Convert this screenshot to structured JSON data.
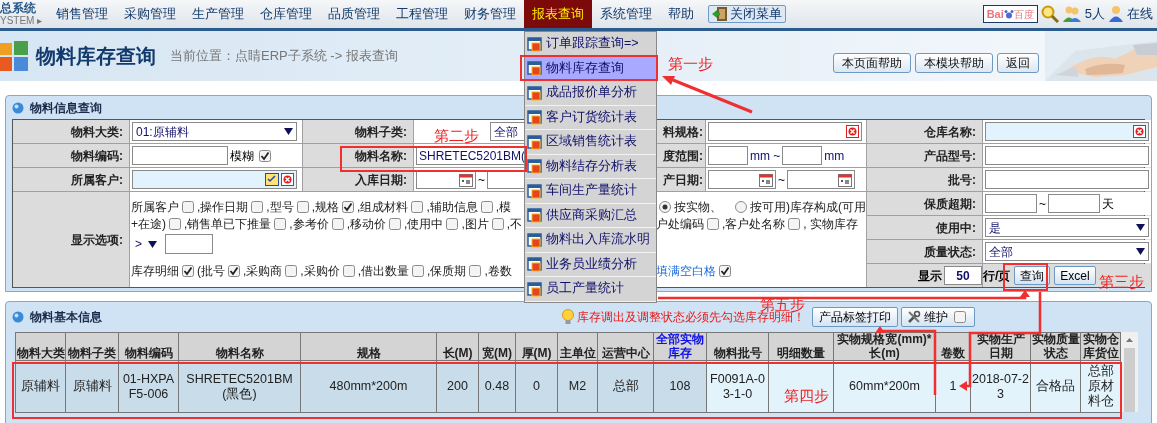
{
  "top_nav": {
    "logo_text": "总系统",
    "logo_sub": "YSTEM ▸",
    "items": [
      {
        "label": "销售管理",
        "selected": false
      },
      {
        "label": "采购管理",
        "selected": false
      },
      {
        "label": "生产管理",
        "selected": false
      },
      {
        "label": "仓库管理",
        "selected": false
      },
      {
        "label": "品质管理",
        "selected": false
      },
      {
        "label": "工程管理",
        "selected": false
      },
      {
        "label": "财务管理",
        "selected": false
      },
      {
        "label": "报表查询",
        "selected": true
      },
      {
        "label": "系统管理",
        "selected": false
      },
      {
        "label": "帮助",
        "selected": false
      }
    ],
    "close_menu_button": "关闭菜单",
    "search_logo_latin": "Bai",
    "search_logo_cjk": "百度",
    "online_count": "5人",
    "online_label": "在线"
  },
  "page_header": {
    "title": "物料库存查询",
    "breadcrumb": "当前位置：点睛ERP子系统 -> 报表查询",
    "buttons": [
      "本页面帮助",
      "本模块帮助",
      "返回"
    ]
  },
  "dropdown_menu": {
    "items": [
      {
        "label": "订单跟踪查询=>",
        "selected": false
      },
      {
        "label": "物料库存查询",
        "selected": true
      },
      {
        "label": "成品报价单分析",
        "selected": false
      },
      {
        "label": "客户订货统计表",
        "selected": false
      },
      {
        "label": "区域销售统计表",
        "selected": false
      },
      {
        "label": "物料结存分析表",
        "selected": false
      },
      {
        "label": "车间生产量统计",
        "selected": false
      },
      {
        "label": "供应商采购汇总",
        "selected": false
      },
      {
        "label": "物料出入库流水明",
        "selected": false
      },
      {
        "label": "业务员业绩分析",
        "selected": false
      },
      {
        "label": "员工产量统计",
        "selected": false
      }
    ]
  },
  "query_panel": {
    "title": "物料信息查询",
    "category_label": "物料大类:",
    "category_value": "01:原辅料",
    "subcategory_label": "物料子类:",
    "subcategory_value": "全部",
    "spec_label": "料规格:",
    "warehouse_label": "仓库名称:",
    "code_label": "物料编码:",
    "fuzzy_label": "模糊",
    "fuzzy_checked": true,
    "name_label": "物料名称:",
    "name_value": "SHRETEC5201BM(",
    "length_label": "度范围:",
    "length_unit_1": "mm ~",
    "length_unit_2": "mm",
    "model_label": "产品型号:",
    "customer_label": "所属客户:",
    "in_date_label": "入库日期:",
    "in_date_sep": "~",
    "prod_date_label": "产日期:",
    "prod_date_sep": "~",
    "batch_label": "批号:",
    "options_label": "显示选项:",
    "options_lines": [
      {
        "left": [
          {
            "kind": "check",
            "label": "所属客户",
            "checked": false
          },
          {
            "kind": "check",
            "label": ",操作日期",
            "checked": false
          },
          {
            "kind": "check",
            "label": ",型号",
            "checked": false
          },
          {
            "kind": "check",
            "label": ",规格",
            "checked": true
          },
          {
            "kind": "check",
            "label": ",组成材料",
            "checked": false
          },
          {
            "kind": "check",
            "label": ",辅助信息",
            "checked": false
          },
          {
            "kind": "text",
            "label": ",模"
          }
        ],
        "right": [
          {
            "kind": "radio",
            "label": "按实物、",
            "checked": true
          },
          {
            "kind": "radio",
            "label": "按可用)库存构成(可用",
            "checked": false
          }
        ]
      },
      {
        "left": [
          {
            "kind": "check",
            "label": "+在途)",
            "checked": false
          },
          {
            "kind": "check",
            "label": ",销售单已下推量",
            "checked": false
          },
          {
            "kind": "check",
            "label": ",参考价",
            "checked": false
          },
          {
            "kind": "check",
            "label": ",移动价",
            "checked": false
          },
          {
            "kind": "check",
            "label": ",使用中",
            "checked": false
          },
          {
            "kind": "check",
            "label": ",图片",
            "checked": false
          },
          {
            "kind": "text",
            "label": ",不"
          }
        ],
        "right": [
          {
            "kind": "check",
            "label": "户处编码",
            "checked": false
          },
          {
            "kind": "check",
            "label": ",客户处名称",
            "checked": false
          },
          {
            "kind": "text",
            "label": ", 实物库存"
          }
        ]
      },
      {
        "left": [
          {
            "kind": "select",
            "label": ">"
          },
          {
            "kind": "input"
          }
        ]
      },
      {
        "left": [
          {
            "kind": "check",
            "label": "库存明细",
            "checked": true
          },
          {
            "kind": "check",
            "label": "(批号",
            "checked": true
          },
          {
            "kind": "check",
            "label": ",采购商",
            "checked": false
          },
          {
            "kind": "check",
            "label": ",采购价",
            "checked": false
          },
          {
            "kind": "check",
            "label": ",借出数量",
            "checked": false
          },
          {
            "kind": "check",
            "label": ",保质期",
            "checked": false
          },
          {
            "kind": "text",
            "label": ",卷数"
          }
        ],
        "right": [
          {
            "kind": "linkcheck",
            "label": "填满空白格",
            "checked": true
          }
        ]
      }
    ],
    "expiry_label": "保质超期:",
    "expiry_sep": "~",
    "expiry_unit": "天",
    "in_use_label": "使用中:",
    "in_use_value": "是",
    "quality_label": "质量状态:",
    "quality_value": "全部",
    "page_size_label": "显示",
    "page_size_value": "50",
    "page_size_unit": "行/页",
    "query_button": "查询",
    "excel_button": "Excel"
  },
  "result_panel": {
    "title": "物料基本信息",
    "warning": "库存调出及调整状态必须先勾选库存明细！",
    "print_button": "产品标签打印",
    "maintain_button": "维护",
    "maintain_checked": false,
    "columns": [
      {
        "label": "物料大类",
        "highlight": false,
        "detail": false
      },
      {
        "label": "物料子类",
        "highlight": false,
        "detail": false
      },
      {
        "label": "物料编码",
        "highlight": false,
        "detail": false
      },
      {
        "label": "物料名称",
        "highlight": false,
        "detail": false
      },
      {
        "label": "规格",
        "highlight": false,
        "detail": false
      },
      {
        "label": "长(M)",
        "highlight": false,
        "detail": false
      },
      {
        "label": "宽(M)",
        "highlight": false,
        "detail": false
      },
      {
        "label": "厚(M)",
        "highlight": false,
        "detail": false
      },
      {
        "label": "主单位",
        "highlight": false,
        "detail": false
      },
      {
        "label": "运营中心",
        "highlight": false,
        "detail": false
      },
      {
        "label": "全部实物库存",
        "highlight": true,
        "detail": false
      },
      {
        "label": "物料批号",
        "highlight": false,
        "detail": true
      },
      {
        "label": "明细数量",
        "highlight": false,
        "detail": true
      },
      {
        "label": "实物规格宽(mm)*长(m)",
        "highlight": false,
        "detail": true
      },
      {
        "label": "卷数",
        "highlight": false,
        "detail": true
      },
      {
        "label": "实物生产日期",
        "highlight": false,
        "detail": true
      },
      {
        "label": "实物质量状态",
        "highlight": false,
        "detail": true
      },
      {
        "label": "实物仓库货位",
        "highlight": false,
        "detail": true
      }
    ],
    "rows": [
      [
        "原辅料",
        "原辅料",
        "01-HXPAF5-006",
        "SHRETEC5201BM(黑色)",
        "480mm*200m",
        "200",
        "0.48",
        "0",
        "M2",
        "总部",
        "108",
        "F0091A-03-1-0",
        "",
        "60mm*200m",
        "1",
        "2018-07-23",
        "合格品",
        "总部原材料仓"
      ]
    ]
  },
  "annotations": [
    {
      "text": "第一步"
    },
    {
      "text": "第二步"
    },
    {
      "text": "第三步"
    },
    {
      "text": "第五步"
    },
    {
      "text": "第四步"
    }
  ]
}
